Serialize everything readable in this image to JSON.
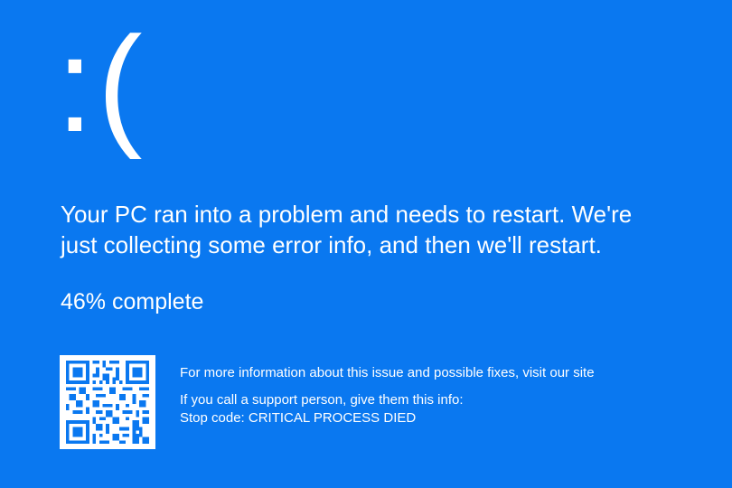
{
  "sad_face": ":(",
  "message": {
    "line1": "Your PC ran into a problem and needs to restart. We're",
    "line2": "just collecting some error info, and then we'll restart."
  },
  "progress": {
    "percent": 46,
    "text": "46% complete"
  },
  "info": {
    "more_info": "For more information about this issue and possible fixes, visit our site",
    "support": "If you call a support person, give them this info:",
    "stop_code": "Stop code: CRITICAL PROCESS DIED"
  },
  "colors": {
    "background": "#0a78f0",
    "text": "#ffffff"
  },
  "icons": {
    "qr": "qr-code-icon"
  }
}
